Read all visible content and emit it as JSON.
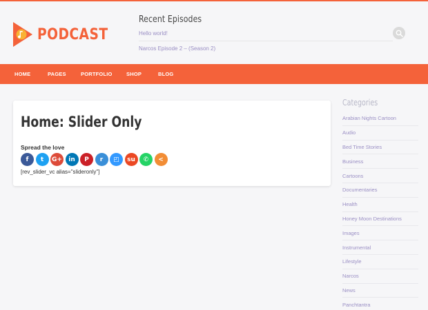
{
  "header": {
    "logo_text": "PODCAST",
    "recent_title": "Recent Episodes",
    "episodes": [
      "Hello world!",
      "Narcos Episode 2 – (Season 2)"
    ]
  },
  "nav": {
    "items": [
      "HOME",
      "PAGES",
      "PORTFOLIO",
      "SHOP",
      "BLOG"
    ]
  },
  "main": {
    "title": "Home: Slider Only",
    "spread_label": "Spread the love",
    "shortcode": "[rev_slider_vc alias=\"slideronly\"]",
    "share_buttons": [
      {
        "name": "facebook-icon",
        "glyph": "f",
        "color": "#3b5998"
      },
      {
        "name": "twitter-icon",
        "glyph": "t",
        "color": "#1da1f2"
      },
      {
        "name": "google-plus-icon",
        "glyph": "G+",
        "color": "#dd4b39"
      },
      {
        "name": "linkedin-icon",
        "glyph": "in",
        "color": "#0077b5"
      },
      {
        "name": "pinterest-icon",
        "glyph": "P",
        "color": "#cb2027"
      },
      {
        "name": "reddit-icon",
        "glyph": "r",
        "color": "#3a8fd8"
      },
      {
        "name": "delicious-icon",
        "glyph": "◰",
        "color": "#3399ff"
      },
      {
        "name": "stumbleupon-icon",
        "glyph": "su",
        "color": "#eb4823"
      },
      {
        "name": "whatsapp-icon",
        "glyph": "✆",
        "color": "#25d366"
      },
      {
        "name": "share-more-icon",
        "glyph": "<",
        "color": "#f28d35"
      }
    ]
  },
  "sidebar": {
    "title": "Categories",
    "categories": [
      "Arabian Nights Cartoon",
      "Audio",
      "Bed Time Stories",
      "Business",
      "Cartoons",
      "Documentaries",
      "Health",
      "Honey Moon Destinations",
      "Images",
      "Instrumental",
      "Lifestyle",
      "Narcos",
      "News",
      "Panchtantra"
    ]
  },
  "colors": {
    "accent": "#f4623a",
    "link": "#9a8fc4"
  }
}
